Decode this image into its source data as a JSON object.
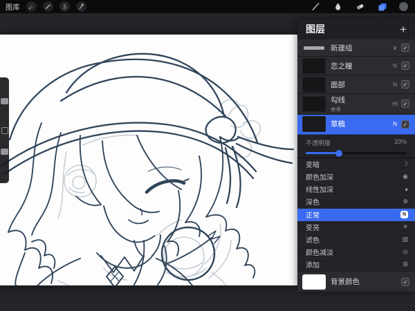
{
  "toolbar": {
    "gallery_label": "图库",
    "selection_glyph": "S",
    "left_tools": [
      "actions-wrench",
      "adjustments-wand",
      "selection-s",
      "transform-arrow"
    ],
    "right_tools": [
      "brush",
      "smudge",
      "eraser",
      "layers",
      "color"
    ]
  },
  "panel": {
    "title": "图层",
    "add_label": "+",
    "group": {
      "name": "新建组"
    },
    "layers": [
      {
        "name": "恋之瞳",
        "blend": "N"
      },
      {
        "name": "面部",
        "blend": "N"
      },
      {
        "name": "勾线",
        "subtitle": "参考",
        "blend": "Hl"
      },
      {
        "name": "草稿",
        "blend": "N",
        "selected": true
      }
    ],
    "opacity": {
      "label": "不透明度",
      "value": "33%"
    },
    "blend_modes": [
      {
        "label": "变暗",
        "glyph": "☽"
      },
      {
        "label": "颜色加深",
        "glyph": "◉"
      },
      {
        "label": "线性加深",
        "glyph": "♦"
      },
      {
        "label": "深色",
        "glyph": "⊕"
      },
      {
        "label": "正常",
        "glyph": "N",
        "selected": true
      },
      {
        "label": "变亮",
        "glyph": "☀"
      },
      {
        "label": "滤色",
        "glyph": "▨"
      },
      {
        "label": "颜色减淡",
        "glyph": "◎"
      },
      {
        "label": "添加",
        "glyph": "⊞"
      }
    ],
    "background": {
      "label": "背景颜色",
      "color": "#ffffff"
    }
  },
  "icons": {
    "check": "✓",
    "chevron": "∨"
  },
  "colors": {
    "accent": "#3a6af0",
    "canvas": "#fdfdfe",
    "line_art": "#31455a"
  }
}
